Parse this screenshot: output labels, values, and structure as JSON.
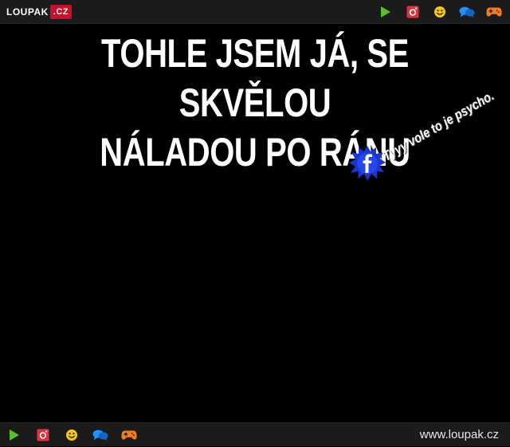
{
  "header": {
    "logo_main": "LOUPAK",
    "logo_tld": ".CZ",
    "icons": [
      "play-icon",
      "instagram-icon",
      "smiley-icon",
      "chat-icon",
      "gamepad-icon"
    ]
  },
  "meme": {
    "line1": "TOHLE JSEM JÁ, SE SKVĚLOU",
    "line2": "NÁLADOU PO RÁNU",
    "watermark_text": "Tyyy vole to je psycho."
  },
  "footer": {
    "icons": [
      "play-icon",
      "instagram-icon",
      "smiley-icon",
      "chat-icon",
      "gamepad-icon"
    ],
    "site_url": "www.loupak.cz"
  },
  "colors": {
    "bar_bg": "#1b1b1b",
    "play": "#5bbf2a",
    "instagram": "#e0323a",
    "smiley": "#f5c518",
    "chat": "#1e90ff",
    "gamepad": "#f57c1f",
    "fb_blue": "#1a37d6"
  }
}
